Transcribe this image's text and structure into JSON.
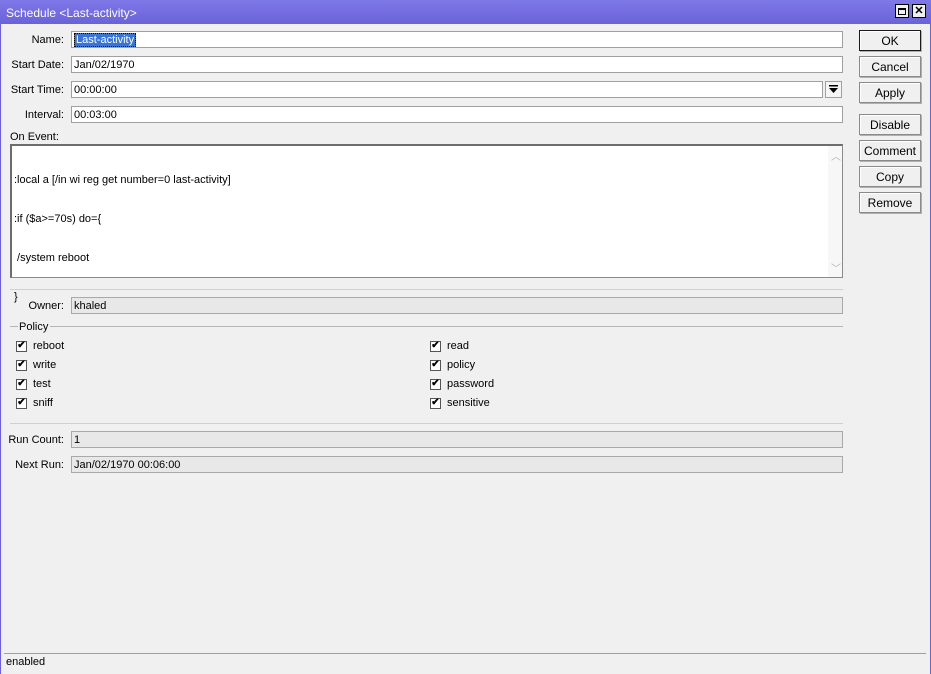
{
  "window": {
    "title": "Schedule <Last-activity>",
    "maximize_icon": "maximize-icon",
    "close_icon": "close-icon",
    "close_glyph": "✕"
  },
  "form": {
    "name_label": "Name:",
    "name_value": "Last-activity",
    "start_date_label": "Start Date:",
    "start_date_value": "Jan/02/1970",
    "start_time_label": "Start Time:",
    "start_time_value": "00:00:00",
    "interval_label": "Interval:",
    "interval_value": "00:03:00",
    "on_event_label": "On Event:",
    "on_event_lines": [
      ":local a [/in wi reg get number=0 last-activity]",
      ":if ($a>=70s) do={",
      " /system reboot",
      "}"
    ],
    "owner_label": "Owner:",
    "owner_value": "khaled",
    "policy_label": "Policy",
    "policies": [
      {
        "label": "reboot",
        "checked": true
      },
      {
        "label": "write",
        "checked": true
      },
      {
        "label": "test",
        "checked": true
      },
      {
        "label": "sniff",
        "checked": true
      },
      {
        "label": "read",
        "checked": true
      },
      {
        "label": "policy",
        "checked": true
      },
      {
        "label": "password",
        "checked": true
      },
      {
        "label": "sensitive",
        "checked": true
      }
    ],
    "check_glyph": "✔",
    "run_count_label": "Run Count:",
    "run_count_value": "1",
    "next_run_label": "Next Run:",
    "next_run_value": "Jan/02/1970 00:06:00"
  },
  "buttons": {
    "ok": "OK",
    "cancel": "Cancel",
    "apply": "Apply",
    "disable": "Disable",
    "comment": "Comment",
    "copy": "Copy",
    "remove": "Remove"
  },
  "status": {
    "text": "enabled"
  },
  "colors": {
    "titlebar": "#6a62d8",
    "selection": "#3875d7"
  }
}
